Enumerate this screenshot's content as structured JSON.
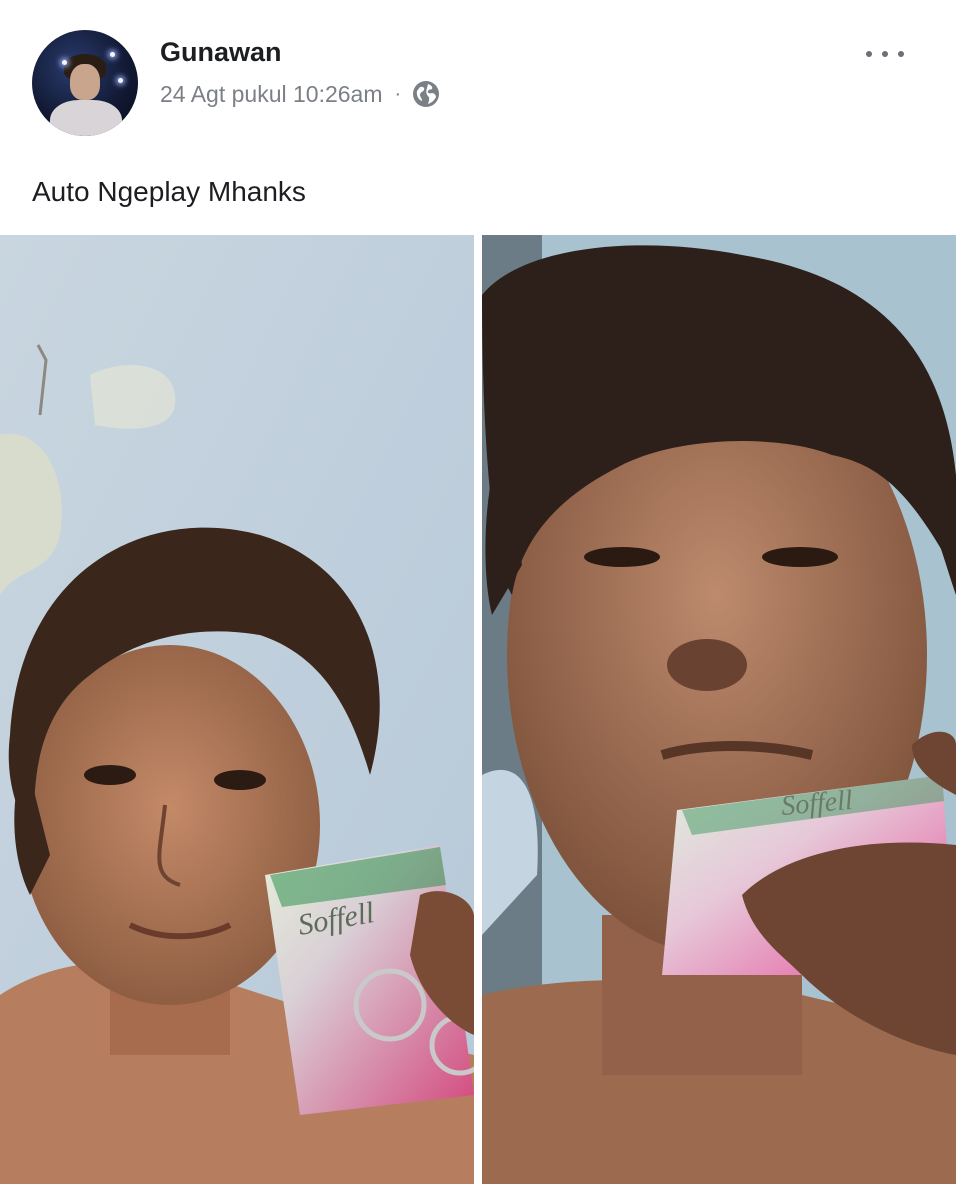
{
  "post": {
    "author": "Gunawan",
    "timestamp": "24 Agt pukul 10:26am",
    "separator": "·",
    "privacy_icon": "globe-icon",
    "more_icon": "more-options-icon",
    "caption": "Auto Ngeplay Mhanks",
    "photos": [
      {
        "name": "photo-left",
        "description": "selfie",
        "package_text": "Soffell"
      },
      {
        "name": "photo-right",
        "description": "selfie",
        "package_text": "Soffell"
      }
    ]
  },
  "colors": {
    "text_primary": "#1c1e21",
    "text_secondary": "#7b7f86",
    "background": "#ffffff",
    "divider": "#e4e6eb"
  }
}
